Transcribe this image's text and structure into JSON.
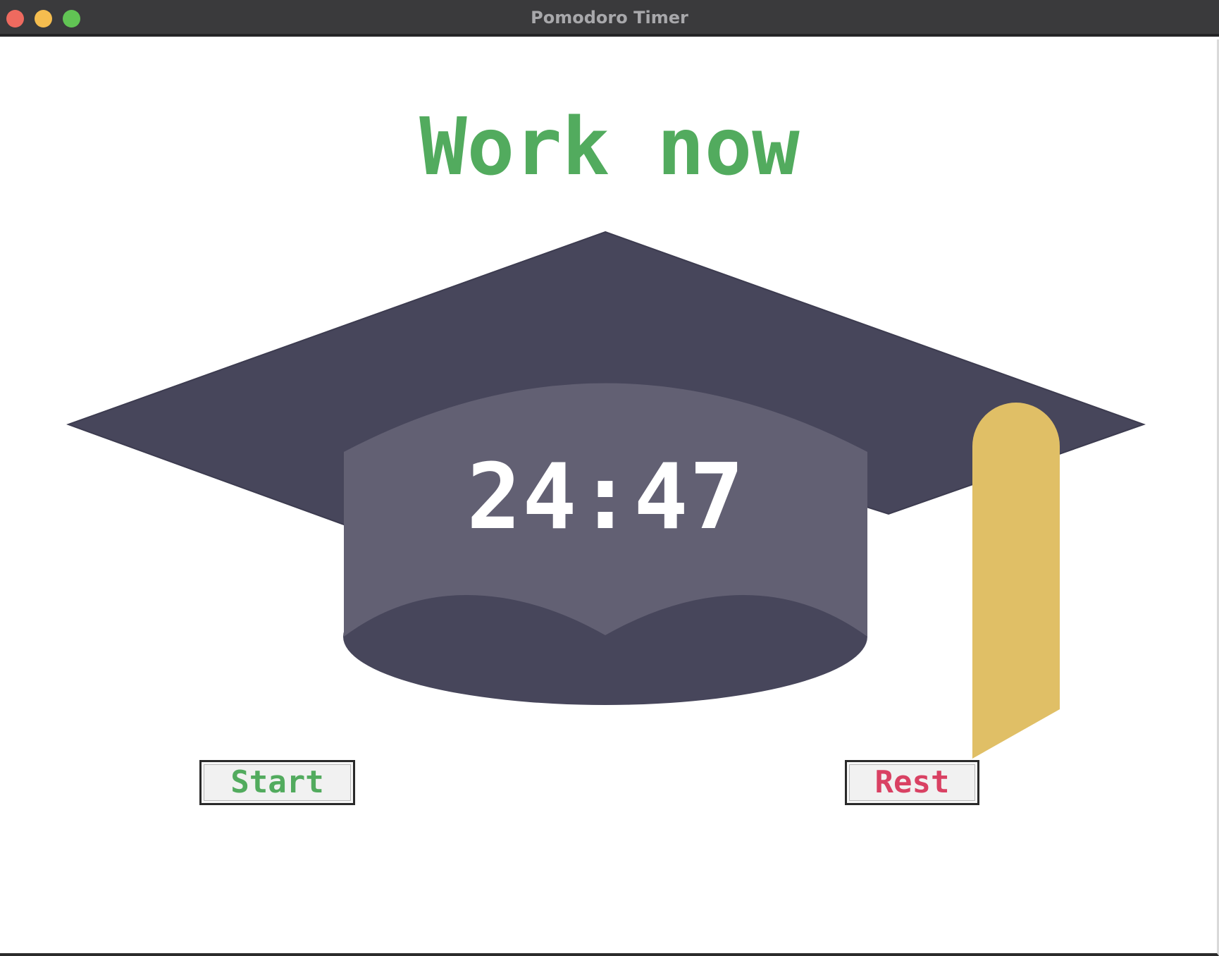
{
  "window": {
    "title": "Pomodoro Timer",
    "controls": [
      "close",
      "minimize",
      "zoom"
    ]
  },
  "main": {
    "heading": "Work now",
    "timer": "24:47",
    "illustration": "graduation-cap-icon"
  },
  "buttons": {
    "start_label": "Start",
    "rest_label": "Rest"
  },
  "colors": {
    "work_green": "#52ab5e",
    "rest_red": "#d94163",
    "cap_dark": "#47465b",
    "cap_band": "#626073",
    "tassel": "#e0bf66"
  }
}
